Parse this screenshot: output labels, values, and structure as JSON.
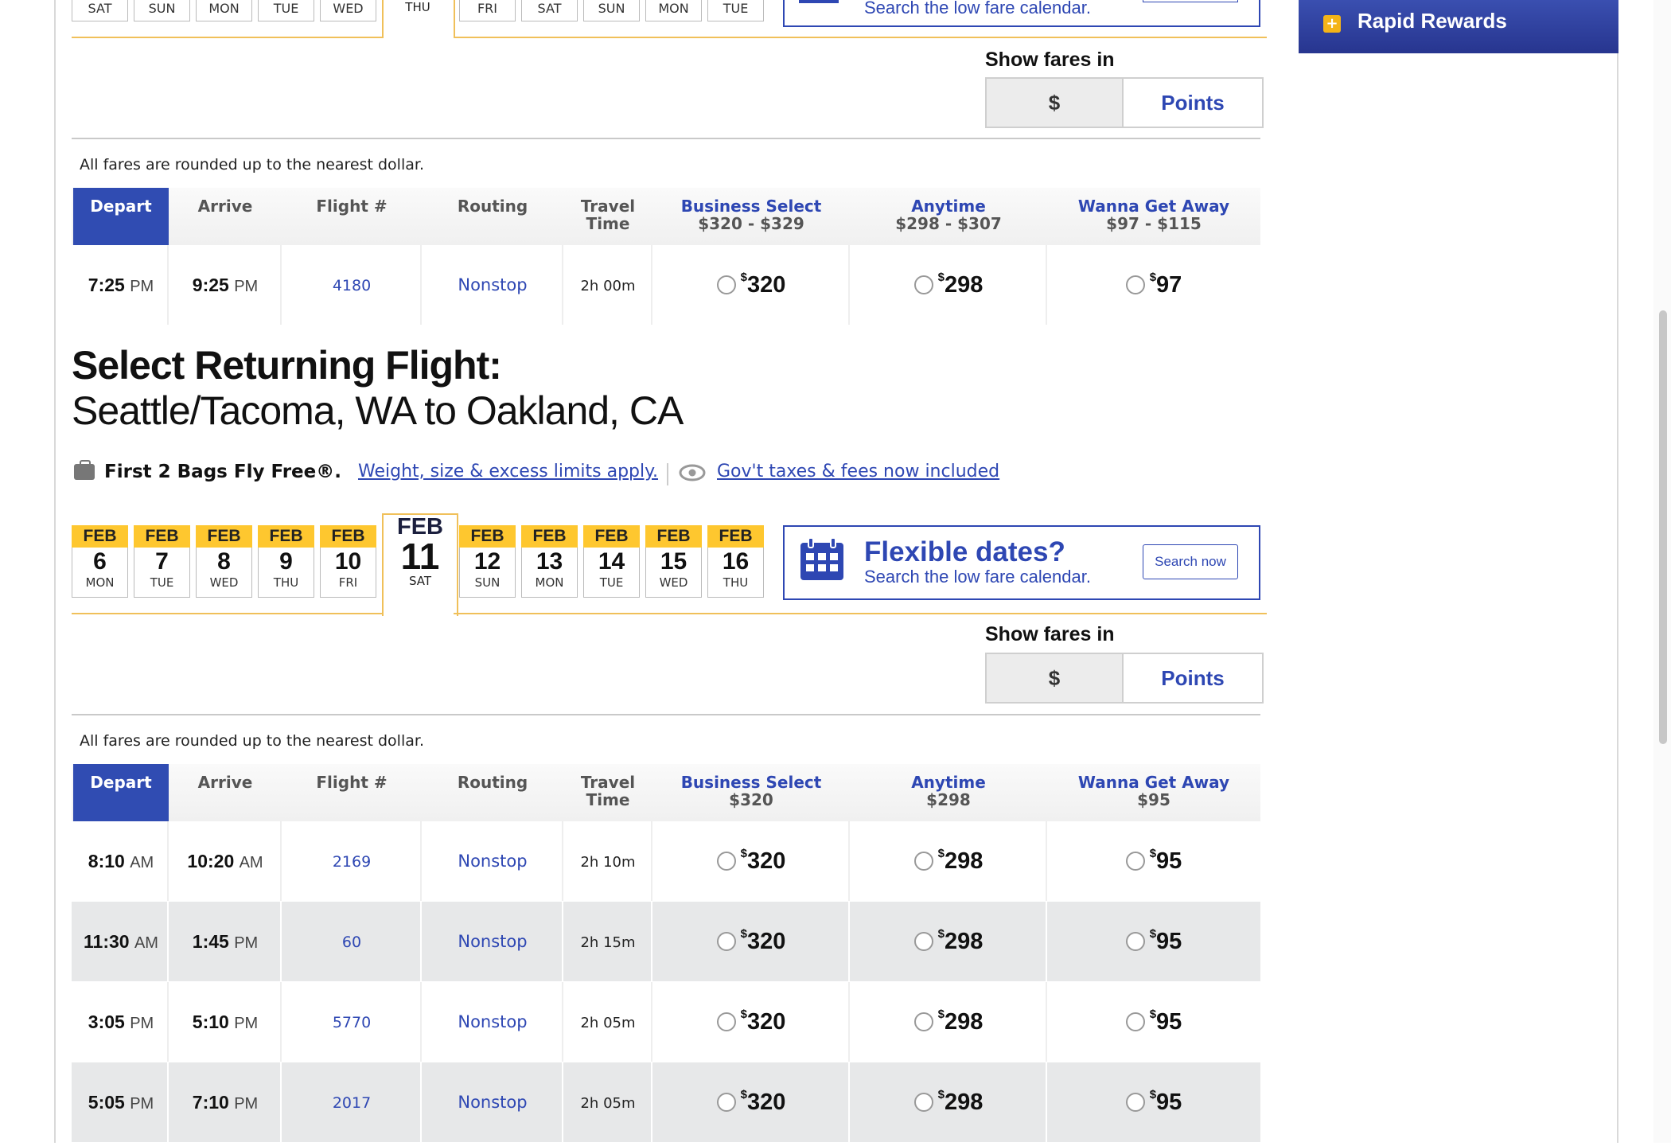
{
  "sidebar": {
    "rapid_rewards_label": "Rapid Rewards"
  },
  "outbound": {
    "date_strip": [
      {
        "dow": "SAT"
      },
      {
        "dow": "SUN"
      },
      {
        "dow": "MON"
      },
      {
        "dow": "TUE"
      },
      {
        "dow": "WED"
      }
    ],
    "selected_dow": "THU",
    "date_strip_after": [
      {
        "dow": "FRI"
      },
      {
        "dow": "SAT"
      },
      {
        "dow": "SUN"
      },
      {
        "dow": "MON"
      },
      {
        "dow": "TUE"
      }
    ],
    "flex_sub": "Search the low fare calendar.",
    "show_fares_label": "Show fares in",
    "toggle": {
      "dollar": "$",
      "points": "Points"
    },
    "rounded_note": "All fares are rounded up to the nearest dollar.",
    "headers": {
      "depart": "Depart",
      "arrive": "Arrive",
      "flight": "Flight #",
      "routing": "Routing",
      "travel_line1": "Travel",
      "travel_line2": "Time",
      "biz_name": "Business Select",
      "biz_range": "$320 - $329",
      "any_name": "Anytime",
      "any_range": "$298 - $307",
      "wga_name": "Wanna Get Away",
      "wga_range": "$97 - $115"
    },
    "flights": [
      {
        "dep_time": "7:25",
        "dep_ampm": "PM",
        "arr_time": "9:25",
        "arr_ampm": "PM",
        "flight": "4180",
        "routing": "Nonstop",
        "travel": "2h 00m",
        "biz": "320",
        "any": "298",
        "wga": "97"
      }
    ]
  },
  "returning": {
    "title": "Select Returning Flight:",
    "route": "Seattle/Tacoma, WA to Oakland, CA",
    "bags_text": "First 2 Bags Fly Free®.",
    "bags_link": "Weight, size & excess limits apply.",
    "taxes_link": "Gov't taxes & fees now included",
    "date_strip": [
      {
        "mon": "FEB",
        "day": "6",
        "dow": "MON"
      },
      {
        "mon": "FEB",
        "day": "7",
        "dow": "TUE"
      },
      {
        "mon": "FEB",
        "day": "8",
        "dow": "WED"
      },
      {
        "mon": "FEB",
        "day": "9",
        "dow": "THU"
      },
      {
        "mon": "FEB",
        "day": "10",
        "dow": "FRI"
      }
    ],
    "selected": {
      "mon": "FEB",
      "day": "11",
      "dow": "SAT"
    },
    "date_strip_after": [
      {
        "mon": "FEB",
        "day": "12",
        "dow": "SUN"
      },
      {
        "mon": "FEB",
        "day": "13",
        "dow": "MON"
      },
      {
        "mon": "FEB",
        "day": "14",
        "dow": "TUE"
      },
      {
        "mon": "FEB",
        "day": "15",
        "dow": "WED"
      },
      {
        "mon": "FEB",
        "day": "16",
        "dow": "THU"
      }
    ],
    "flex_title": "Flexible dates?",
    "flex_sub": "Search the low fare calendar.",
    "flex_button": "Search now",
    "show_fares_label": "Show fares in",
    "toggle": {
      "dollar": "$",
      "points": "Points"
    },
    "rounded_note": "All fares are rounded up to the nearest dollar.",
    "headers": {
      "depart": "Depart",
      "arrive": "Arrive",
      "flight": "Flight #",
      "routing": "Routing",
      "travel_line1": "Travel",
      "travel_line2": "Time",
      "biz_name": "Business Select",
      "biz_range": "$320",
      "any_name": "Anytime",
      "any_range": "$298",
      "wga_name": "Wanna Get Away",
      "wga_range": "$95"
    },
    "flights": [
      {
        "dep_time": "8:10",
        "dep_ampm": "AM",
        "arr_time": "10:20",
        "arr_ampm": "AM",
        "flight": "2169",
        "routing": "Nonstop",
        "travel": "2h 10m",
        "biz": "320",
        "any": "298",
        "wga": "95"
      },
      {
        "dep_time": "11:30",
        "dep_ampm": "AM",
        "arr_time": "1:45",
        "arr_ampm": "PM",
        "flight": "60",
        "routing": "Nonstop",
        "travel": "2h 15m",
        "biz": "320",
        "any": "298",
        "wga": "95"
      },
      {
        "dep_time": "3:05",
        "dep_ampm": "PM",
        "arr_time": "5:10",
        "arr_ampm": "PM",
        "flight": "5770",
        "routing": "Nonstop",
        "travel": "2h 05m",
        "biz": "320",
        "any": "298",
        "wga": "95"
      },
      {
        "dep_time": "5:05",
        "dep_ampm": "PM",
        "arr_time": "7:10",
        "arr_ampm": "PM",
        "flight": "2017",
        "routing": "Nonstop",
        "travel": "2h 05m",
        "biz": "320",
        "any": "298",
        "wga": "95"
      }
    ]
  },
  "colors": {
    "brand_blue": "#304cb2",
    "link_blue": "#2e47b3",
    "gold": "#fec72f",
    "alt_row": "#e7e8e9"
  },
  "icons": {
    "rapid_rewards": "plus-icon",
    "calendar": "calendar-icon",
    "bag": "bag-icon",
    "eye": "eye-icon",
    "radio": "radio-icon"
  }
}
